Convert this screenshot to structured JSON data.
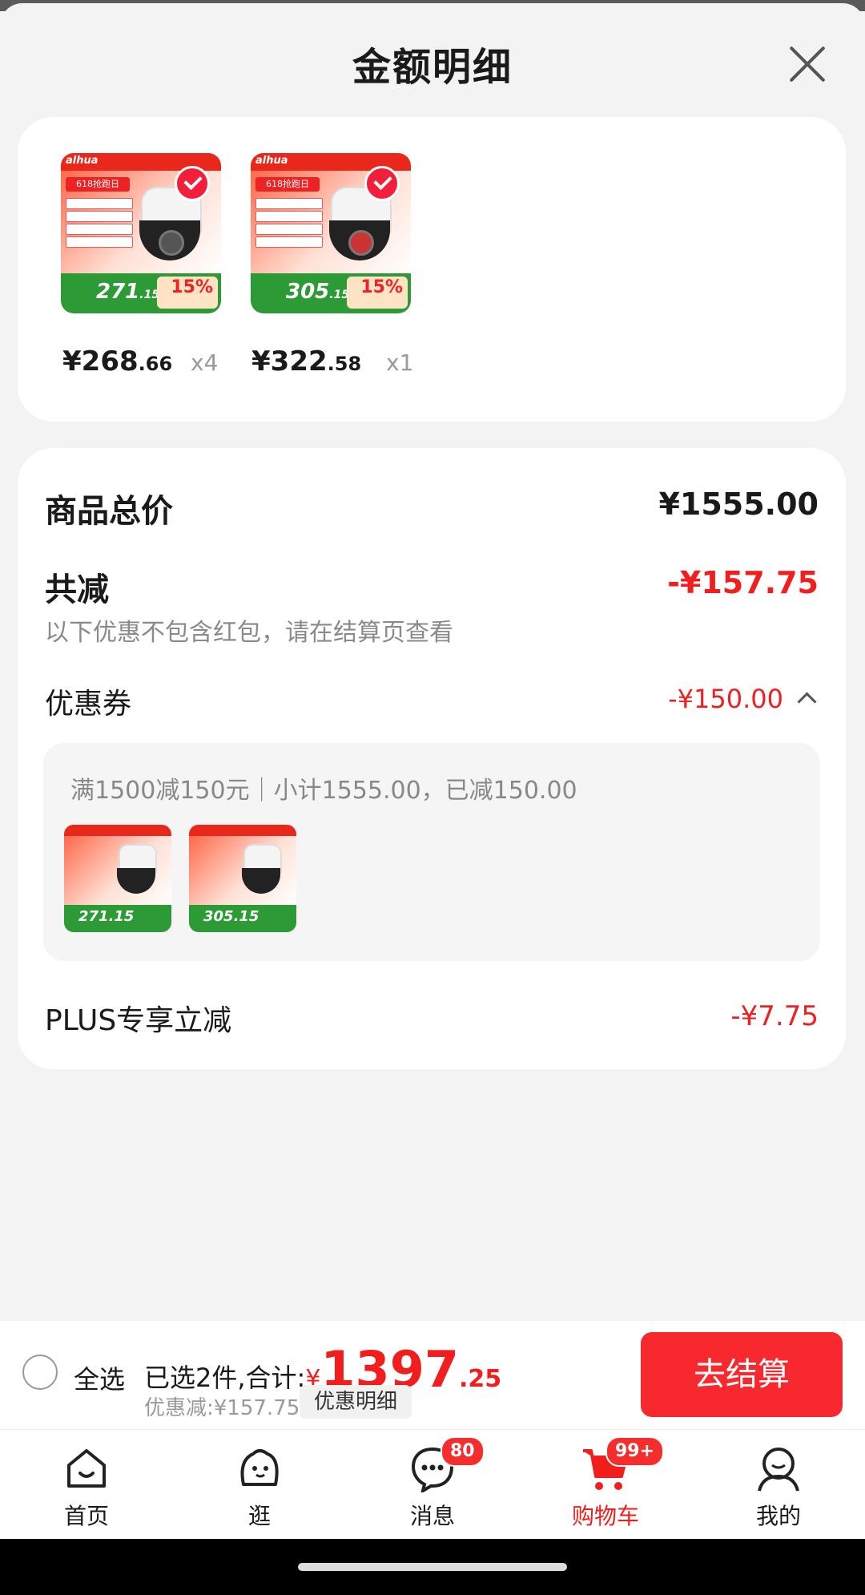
{
  "sheet": {
    "title": "金额明细"
  },
  "products": [
    {
      "brand": "alhua",
      "promo_price": "271",
      "promo_price_dec": ".15",
      "discount_pct": "15%",
      "price_int": "¥268",
      "price_dec": ".66",
      "qty": "x4"
    },
    {
      "brand": "alhua",
      "promo_price": "305",
      "promo_price_dec": ".15",
      "discount_pct": "15%",
      "price_int": "¥322",
      "price_dec": ".58",
      "qty": "x1"
    }
  ],
  "summary": {
    "total_label": "商品总价",
    "total_value": "¥1555.00",
    "reduce_label": "共减",
    "reduce_value": "-¥157.75",
    "reduce_note": "以下优惠不包含红包，请在结算页查看",
    "coupon_label": "优惠券",
    "coupon_value": "-¥150.00",
    "coupon_detail": "满1500减150元｜小计1555.00，已减150.00",
    "coupon_items": [
      {
        "promo_price": "271.15"
      },
      {
        "promo_price": "305.15"
      }
    ],
    "plus_label": "PLUS专享立减",
    "plus_value": "-¥7.75"
  },
  "checkout": {
    "select_all": "全选",
    "selected_text": "已选2件,合计:",
    "currency": "¥",
    "total_int": "1397",
    "total_dec": ".25",
    "discount_text": "优惠减:¥157.75",
    "detail_button": "优惠明细",
    "checkout_button": "去结算"
  },
  "tabbar": {
    "items": [
      {
        "label": "首页",
        "icon": "home-icon"
      },
      {
        "label": "逛",
        "icon": "browse-icon"
      },
      {
        "label": "消息",
        "icon": "message-icon",
        "badge": "80"
      },
      {
        "label": "购物车",
        "icon": "cart-icon",
        "badge": "99+",
        "active": true
      },
      {
        "label": "我的",
        "icon": "profile-icon"
      }
    ]
  },
  "colors": {
    "accent": "#f21e1e",
    "button": "#f7282e"
  }
}
